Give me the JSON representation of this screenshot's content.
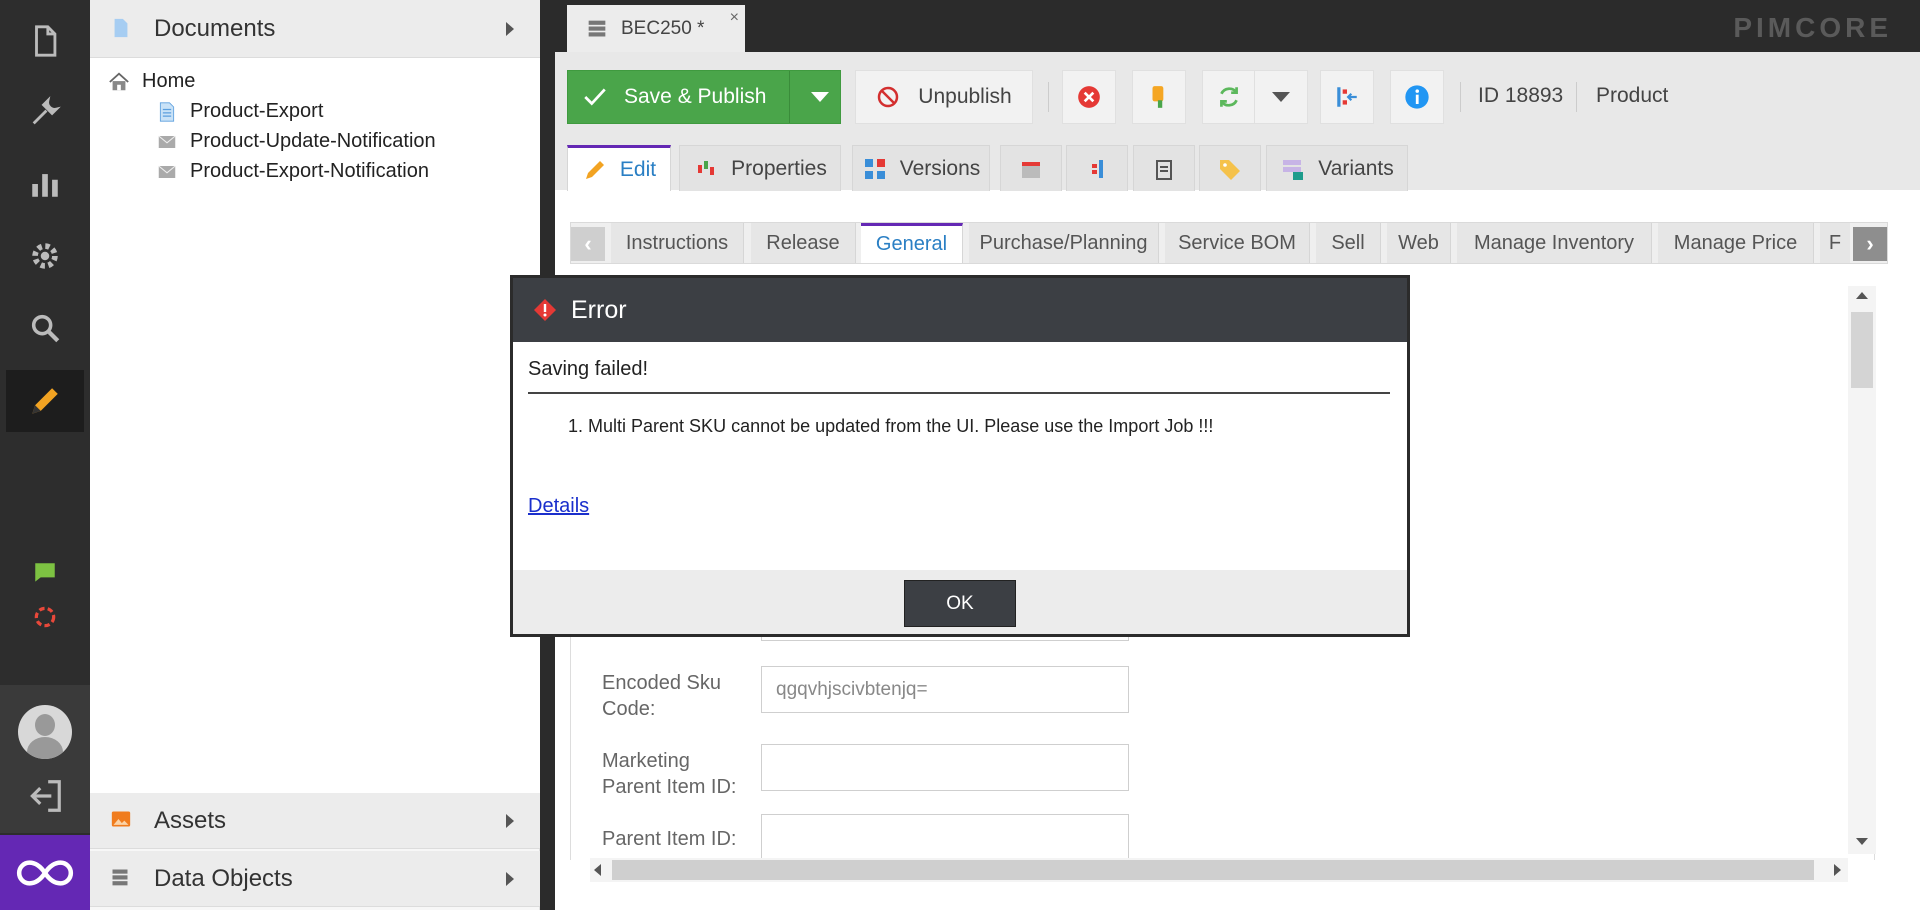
{
  "nav": {
    "items": [
      "documents-icon",
      "tools-icon",
      "analytics-icon",
      "settings-icon",
      "search-icon",
      "edit-icon"
    ],
    "extra": [
      "chat-icon",
      "sync-icon"
    ],
    "user": "avatar-icon",
    "logout": "logout-icon",
    "brand": "pimcore-brand-icon"
  },
  "tree": {
    "documents_label": "Documents",
    "assets_label": "Assets",
    "objects_label": "Data Objects",
    "nodes": [
      "Home",
      "Product-Export",
      "Product-Update-Notification",
      "Product-Export-Notification"
    ]
  },
  "header": {
    "tab_label": "BEC250 *",
    "tab_close": "×",
    "logo": "PIMCORE"
  },
  "toolbar": {
    "save_publish": "Save & Publish",
    "unpublish": "Unpublish",
    "id": "ID 18893",
    "type": "Product"
  },
  "edit_tabs": [
    "Edit",
    "Properties",
    "Versions",
    "Variants"
  ],
  "layout_tabs": [
    "Instructions",
    "Release",
    "General",
    "Purchase/Planning",
    "Service BOM",
    "Sell",
    "Web",
    "Manage Inventory",
    "Manage Price",
    "F"
  ],
  "form": {
    "encoded_label": "Encoded Sku Code:",
    "encoded_value": "qgqvhjscivbtenjq=",
    "marketing_label": "Marketing Parent Item ID:",
    "parent_label": "Parent Item ID:"
  },
  "dialog": {
    "title": "Error",
    "subtitle": "Saving failed!",
    "message": "1. Multi Parent SKU cannot be updated from the UI. Please use the Import Job !!!",
    "details": "Details",
    "ok": "OK"
  },
  "colors": {
    "accent": "#6428b4",
    "save_green": "#4aa54a",
    "nav_bg": "#2d2d2d",
    "dialog_head": "#3c3f44",
    "edit_orange": "#f2a322"
  }
}
